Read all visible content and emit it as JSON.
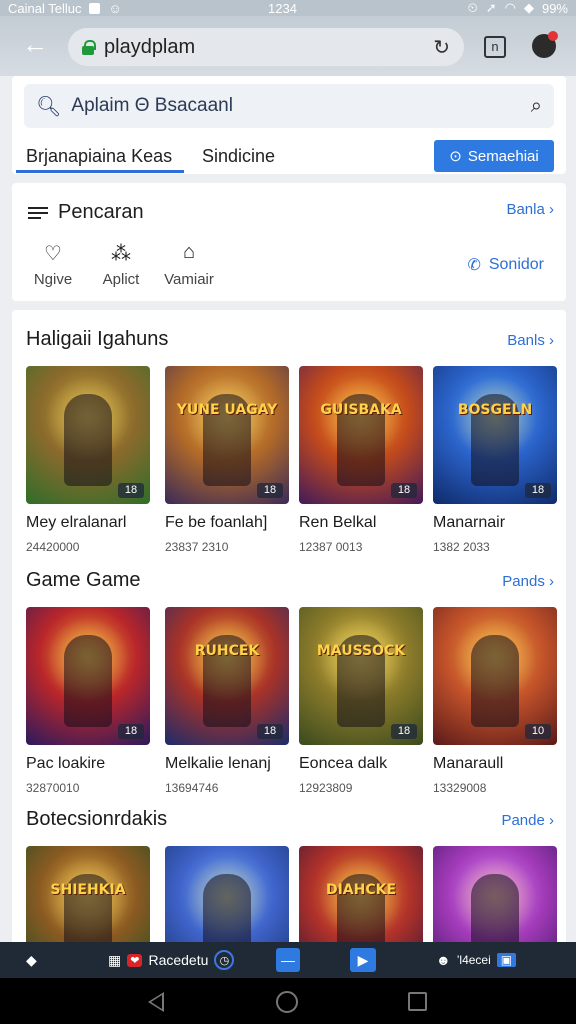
{
  "status_bar": {
    "carrier": "Cainal Telluc",
    "time": "1234",
    "battery": "99%"
  },
  "browser": {
    "url": "playdplam",
    "tab_count": "n"
  },
  "search": {
    "placeholder": "Aplaim Θ Bsacaanl",
    "tab_primary": "Brjanapiaina Keas",
    "tab_secondary": "Sindicine",
    "cta_label": "Semaehiai"
  },
  "quick": {
    "title": "Pencaran",
    "more": "Banla",
    "items": [
      {
        "label": "Ngive",
        "icon": "heart-icon"
      },
      {
        "label": "Aplict",
        "icon": "apps-icon"
      },
      {
        "label": "Vamiair",
        "icon": "bag-icon"
      }
    ],
    "call_label": "Sonidor"
  },
  "sections": [
    {
      "title": "Haligaii Igahuns",
      "more": "Banls",
      "games": [
        {
          "name": "Mey elralanarl",
          "sub": "24420000",
          "badge": "18",
          "logo": "",
          "colors": [
            "#2f6d2a",
            "#8a6a2c",
            "#c9a23a"
          ]
        },
        {
          "name": "Fe be foanlah]",
          "sub": "23837 2310",
          "badge": "18",
          "logo": "YUNE UAGAY",
          "colors": [
            "#3a2a58",
            "#b26a28",
            "#e7b04a"
          ]
        },
        {
          "name": "Ren Belkal",
          "sub": "12387 0013",
          "badge": "18",
          "logo": "GUISBAKA",
          "colors": [
            "#421a5a",
            "#c24a1c",
            "#f39a2a"
          ]
        },
        {
          "name": "Manarnair",
          "sub": "1382 2033",
          "badge": "18",
          "logo": "BOSGELN",
          "colors": [
            "#0f2a6a",
            "#2a62c8",
            "#5aa6ff"
          ]
        }
      ]
    },
    {
      "title": "Game Game",
      "more": "Pands",
      "games": [
        {
          "name": "Pac loakire",
          "sub": "32870010",
          "badge": "18",
          "logo": "",
          "colors": [
            "#2a1a5e",
            "#b8262a",
            "#f0a12a"
          ]
        },
        {
          "name": "Melkalie lenanj",
          "sub": "13694746",
          "badge": "18",
          "logo": "RUHCEK",
          "colors": [
            "#1c2c6a",
            "#a83228",
            "#f0a830"
          ]
        },
        {
          "name": "Eoncea dalk",
          "sub": "12923809",
          "badge": "18",
          "logo": "MAUSSOCK",
          "colors": [
            "#3a4a1e",
            "#8a7a2a",
            "#e6c44a"
          ]
        },
        {
          "name": "Manaraull",
          "sub": "13329008",
          "badge": "10",
          "logo": "",
          "colors": [
            "#5a1a1a",
            "#c2522a",
            "#f3a63a"
          ]
        }
      ]
    },
    {
      "title": "Botecsionrdakis",
      "more": "Pande",
      "games": [
        {
          "name": "",
          "sub": "",
          "badge": "",
          "logo": "SHIEHKIA",
          "colors": [
            "#1e4a22",
            "#8a5a22",
            "#e8b040"
          ]
        },
        {
          "name": "",
          "sub": "",
          "badge": "",
          "logo": "",
          "colors": [
            "#14306a",
            "#3e62c8",
            "#7ab0ff"
          ]
        },
        {
          "name": "",
          "sub": "",
          "badge": "",
          "logo": "DIAHCKE",
          "colors": [
            "#2a1238",
            "#b2322a",
            "#f0a02a"
          ]
        },
        {
          "name": "",
          "sub": "",
          "badge": "",
          "logo": "",
          "colors": [
            "#3a1460",
            "#a23ab8",
            "#e08aff"
          ]
        }
      ]
    }
  ],
  "taskbar": {
    "app_label": "Racedetu",
    "right_label": "’l4ecei"
  }
}
